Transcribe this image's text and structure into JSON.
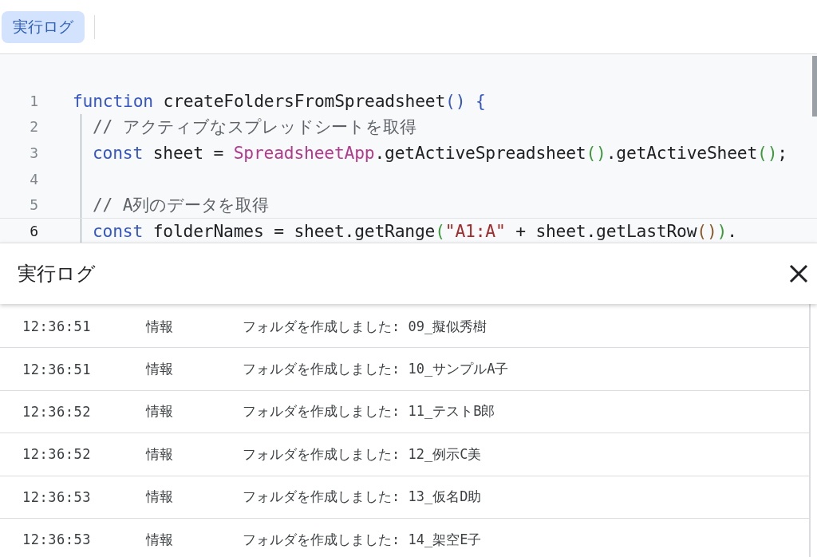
{
  "toolbar": {
    "tabs": [
      {
        "label": "実行ログ",
        "selected": true
      }
    ]
  },
  "editor": {
    "lines": [
      {
        "number": "1",
        "indented": false,
        "current": false,
        "tokens": [
          {
            "kind": "keyword",
            "text": "function"
          },
          {
            "kind": "plain",
            "text": " createFoldersFromSpreadsheet"
          },
          {
            "kind": "bracket1",
            "text": "() {"
          }
        ]
      },
      {
        "number": "2",
        "indented": true,
        "current": false,
        "tokens": [
          {
            "kind": "comment",
            "text": "// アクティブなスプレッドシートを取得"
          }
        ]
      },
      {
        "number": "3",
        "indented": true,
        "current": false,
        "tokens": [
          {
            "kind": "keyword",
            "text": "const"
          },
          {
            "kind": "plain",
            "text": " sheet = "
          },
          {
            "kind": "class",
            "text": "SpreadsheetApp"
          },
          {
            "kind": "plain",
            "text": ".getActiveSpreadsheet"
          },
          {
            "kind": "bracket2",
            "text": "()"
          },
          {
            "kind": "plain",
            "text": ".getActiveSheet"
          },
          {
            "kind": "bracket2",
            "text": "()"
          },
          {
            "kind": "plain",
            "text": ";"
          }
        ]
      },
      {
        "number": "4",
        "indented": true,
        "current": false
      },
      {
        "number": "5",
        "indented": true,
        "current": false,
        "tokens": [
          {
            "kind": "comment",
            "text": "// A列のデータを取得"
          }
        ]
      },
      {
        "number": "6",
        "indented": true,
        "current": true,
        "tokens": [
          {
            "kind": "keyword",
            "text": "const"
          },
          {
            "kind": "plain",
            "text": " folderNames = sheet.getRange"
          },
          {
            "kind": "bracket2",
            "text": "("
          },
          {
            "kind": "string",
            "text": "\"A1:A\""
          },
          {
            "kind": "plain",
            "text": " + sheet.getLastRow"
          },
          {
            "kind": "bracket3",
            "text": "()"
          },
          {
            "kind": "bracket2",
            "text": ")"
          },
          {
            "kind": "plain",
            "text": "."
          }
        ]
      }
    ]
  },
  "log_panel": {
    "title": "実行ログ",
    "rows": [
      {
        "time": "12:36:51",
        "level": "情報",
        "message": "フォルダを作成しました: 09_擬似秀樹"
      },
      {
        "time": "12:36:51",
        "level": "情報",
        "message": "フォルダを作成しました: 10_サンプルA子"
      },
      {
        "time": "12:36:52",
        "level": "情報",
        "message": "フォルダを作成しました: 11_テストB郎"
      },
      {
        "time": "12:36:52",
        "level": "情報",
        "message": "フォルダを作成しました: 12_例示C美"
      },
      {
        "time": "12:36:53",
        "level": "情報",
        "message": "フォルダを作成しました: 13_仮名D助"
      },
      {
        "time": "12:36:53",
        "level": "情報",
        "message": "フォルダを作成しました: 14_架空E子"
      }
    ]
  }
}
